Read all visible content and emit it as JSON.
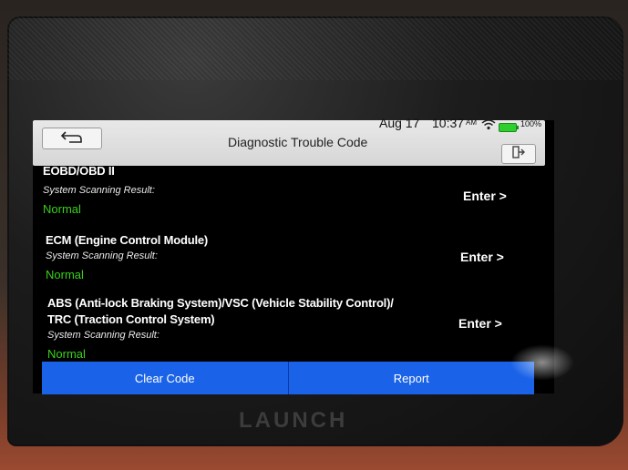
{
  "status_bar": {
    "date": "Aug 17",
    "time": "10:37",
    "ampm": "AM",
    "battery": "100%"
  },
  "header": {
    "title": "Diagnostic Trouble Code"
  },
  "systems": [
    {
      "name": "EOBD/OBD II",
      "result_label": "System Scanning Result:",
      "status": "Normal",
      "action": "Enter >"
    },
    {
      "name": "ECM (Engine Control Module)",
      "result_label": "System Scanning Result:",
      "status": "Normal",
      "action": "Enter >"
    },
    {
      "name": "ABS (Anti-lock Braking System)/VSC (Vehicle Stability Control)/",
      "name_line2": "TRC (Traction Control System)",
      "result_label": "System Scanning Result:",
      "status": "Normal",
      "action": "Enter >"
    }
  ],
  "footer": {
    "clear_code": "Clear Code",
    "report": "Report"
  },
  "device": {
    "brand": "LAUNCH"
  },
  "colors": {
    "accent": "#1a63e8",
    "status_ok": "#39d11a",
    "battery": "#2fce2f"
  }
}
